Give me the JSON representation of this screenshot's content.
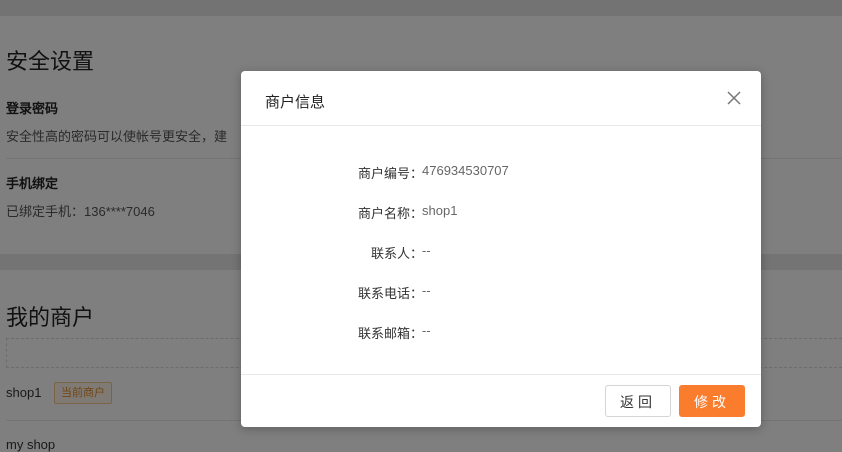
{
  "security": {
    "title": "安全设置",
    "password_title": "登录密码",
    "password_desc": "安全性高的密码可以使帐号更安全，建",
    "phone_title": "手机绑定",
    "phone_desc": "已绑定手机：136****7046"
  },
  "merchants": {
    "title": "我的商户",
    "items": [
      {
        "name": "shop1",
        "badge": "当前商户"
      },
      {
        "name": "my shop"
      }
    ]
  },
  "dialog": {
    "title": "商户信息",
    "fields": [
      {
        "label": "商户编号：",
        "value": "476934530707"
      },
      {
        "label": "商户名称：",
        "value": "shop1"
      },
      {
        "label": "联系人：",
        "value": "--"
      },
      {
        "label": "联系电话：",
        "value": "--"
      },
      {
        "label": "联系邮箱：",
        "value": "--"
      }
    ],
    "back_label": "返回",
    "edit_label": "修改",
    "close_icon": "close-icon"
  },
  "colors": {
    "accent": "#fa7d2e",
    "badge_text": "#e08a2c"
  }
}
